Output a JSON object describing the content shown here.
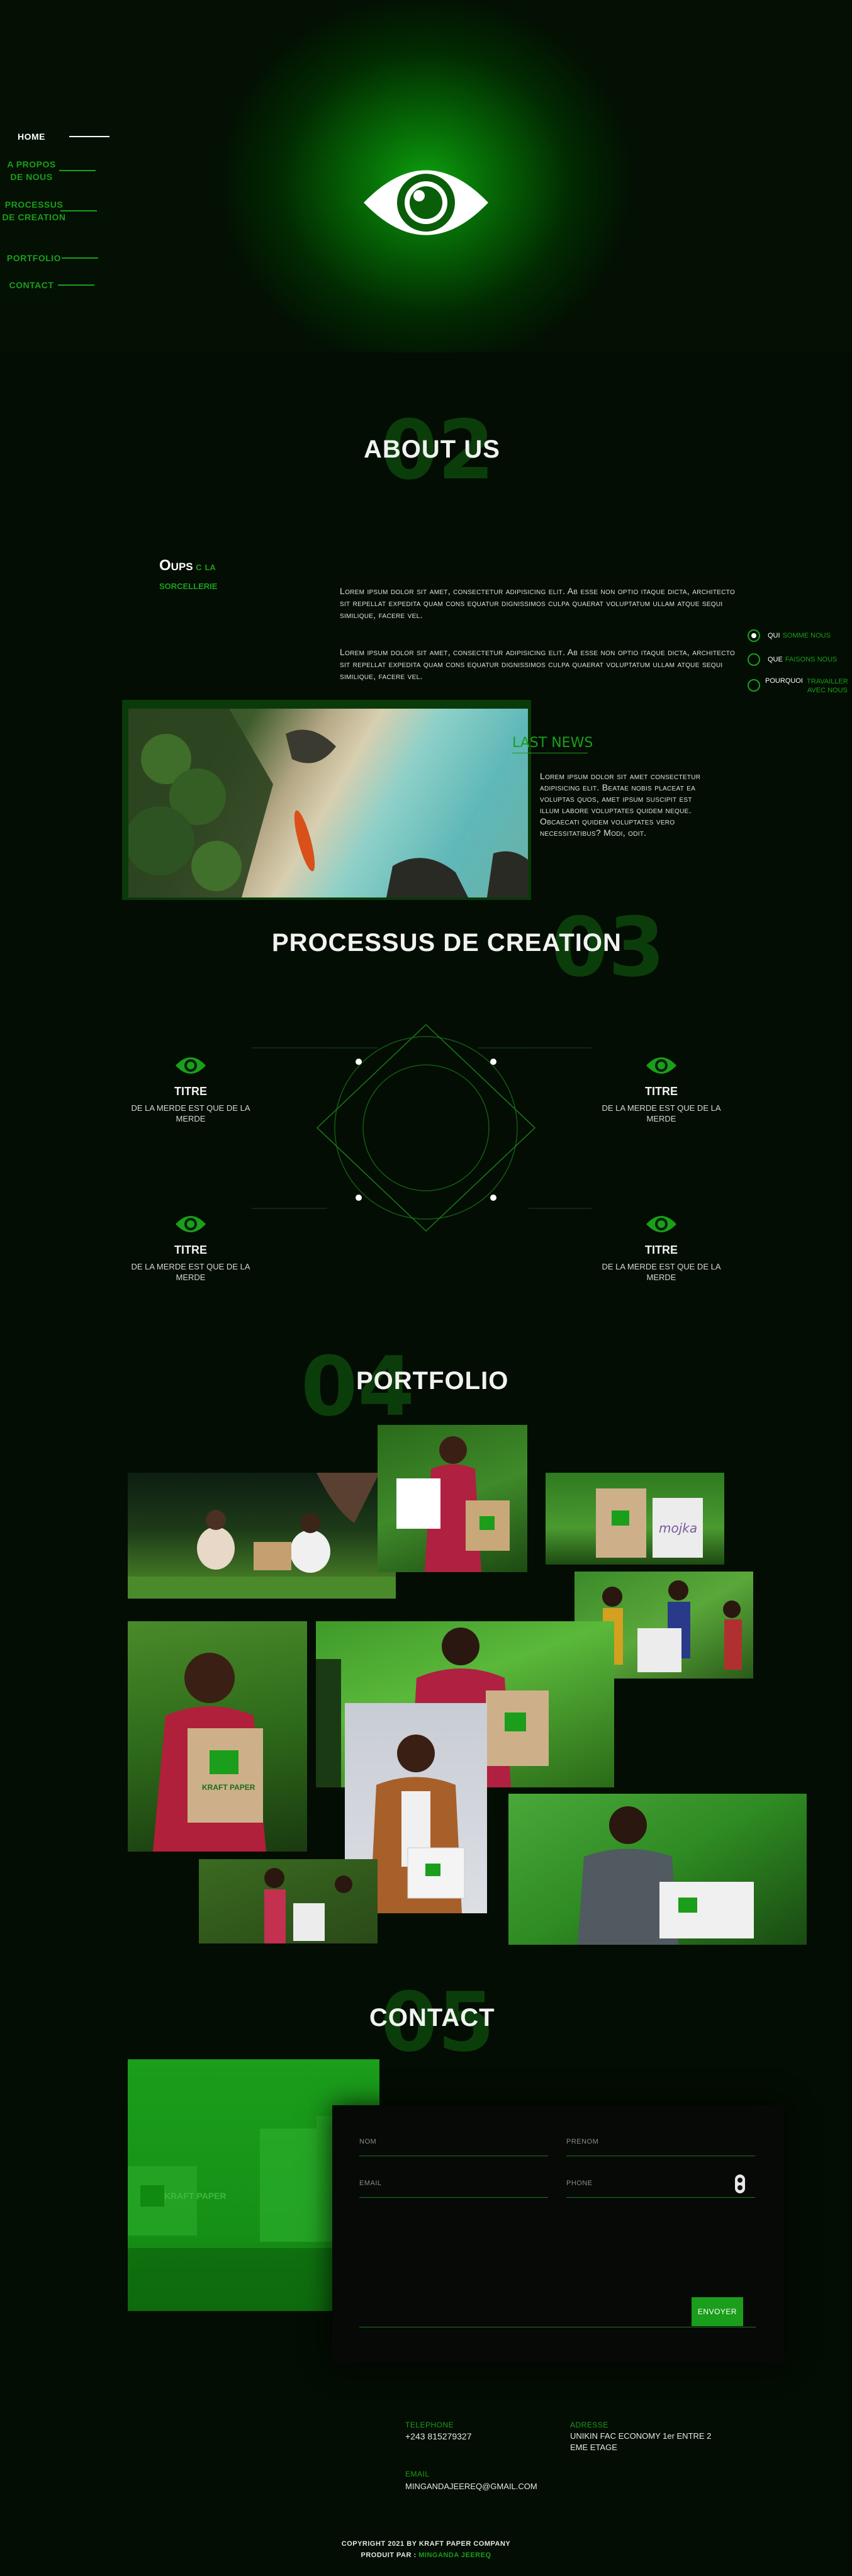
{
  "nav": {
    "items": [
      {
        "label": "HOME",
        "active": true
      },
      {
        "label": "A PROPOS DE NOUS",
        "active": false
      },
      {
        "label": "PROCESSUS DE CREATION",
        "active": false
      },
      {
        "label": "PORTFOLIO",
        "active": false
      },
      {
        "label": "CONTACT",
        "active": false
      }
    ]
  },
  "hero": {
    "logo_icon": "eye-icon"
  },
  "about": {
    "number": "02",
    "title": "ABOUT US",
    "headline_white": "Oups",
    "headline_green": "c la sorcellerie",
    "paragraph1": "Lorem ipsum dolor sit amet, consectetur adipisicing elit. Ab esse non optio itaque dicta, architecto sit repellat expedita quam cons equatur dignissimos culpa quaerat voluptatum ullam atque sequi similique, facere vel.",
    "paragraph2": "Lorem ipsum dolor sit amet, consectetur adipisicing elit. Ab esse non optio itaque dicta, architecto sit repellat expedita quam cons equatur dignissimos culpa quaerat voluptatum ullam atque sequi similique, facere vel.",
    "last_news_title": "LAST NEWS",
    "last_news_text": "Lorem ipsum dolor sit amet consectetur adipisicing elit. Beatae nobis placeat ea voluptas quos, amet ipsum suscipit est illum labore voluptates quidem neque. Obcaecati quidem voluptates vero necessitatibus? Modi, odit.",
    "side_nav": [
      {
        "white": "QUI",
        "green": "SOMME NOUS",
        "active": true
      },
      {
        "white": "QUE",
        "green": "FAISONS NOUS",
        "active": false
      },
      {
        "white": "POURQUOI",
        "green": "TRAVAILLER AVEC NOUS",
        "active": false
      }
    ]
  },
  "process": {
    "number": "03",
    "title": "PROCESSUS DE CREATION",
    "steps": [
      {
        "title": "TITRE",
        "text": "DE LA MERDE EST QUE DE LA MERDE"
      },
      {
        "title": "TITRE",
        "text": "DE LA MERDE EST QUE DE LA MERDE"
      },
      {
        "title": "TITRE",
        "text": "DE LA MERDE EST QUE DE LA MERDE"
      },
      {
        "title": "TITRE",
        "text": "DE LA MERDE EST QUE DE LA MERDE"
      }
    ]
  },
  "portfolio": {
    "number": "04",
    "title": "PORTFOLIO",
    "brand_on_bags": "KRAFT PAPER",
    "bag_logo": "KP",
    "alt_brand": "mojka"
  },
  "contact": {
    "number": "05",
    "title": "CONTACT",
    "fields": {
      "nom": "NOM",
      "prenom": "PRENOM",
      "email": "EMAIL",
      "phone": "PHONE"
    },
    "submit_label": "ENVOYER",
    "image_brand": "KRAFT PAPER"
  },
  "footer": {
    "telephone_label": "TELEPHONE",
    "telephone_value": "+243 815279327",
    "adresse_label": "ADRESSE",
    "adresse_value": "UNIKIN FAC ECONOMY 1er ENTRE 2 EME ETAGE",
    "email_label": "EMAIL",
    "email_value": "MINGANDAJEEREQ@GMAIL.COM",
    "copyright_prefix": "COPYRIGHT 2021 BY KRAFT PAPER COMPANY",
    "produced_prefix": "PRODUIT PAR :",
    "produced_name": "MINGANDA JEEREQ"
  },
  "colors": {
    "accent": "#1b9e1b",
    "background": "#030d03",
    "number_ghost": "#0b3d0b"
  }
}
